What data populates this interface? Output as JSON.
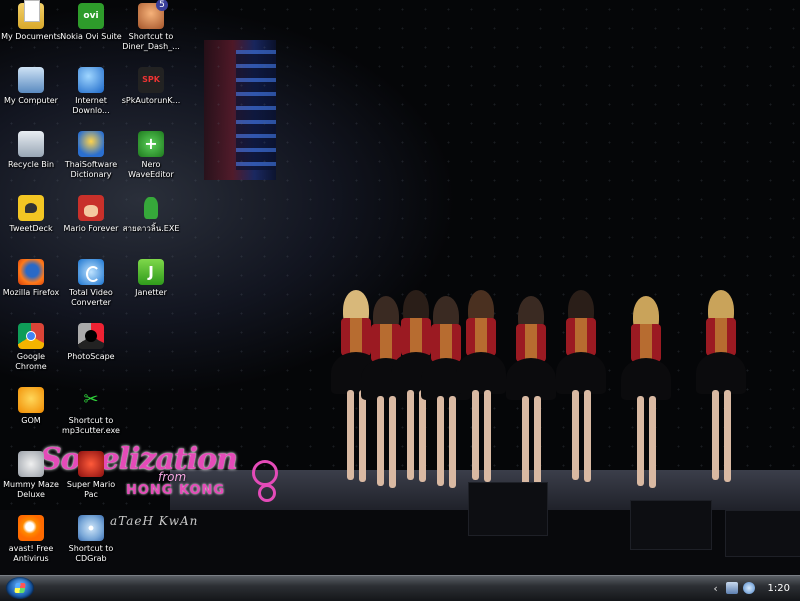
{
  "desktop": {
    "icons": [
      {
        "label": "My Documents",
        "icon": "documents-folder-icon"
      },
      {
        "label": "Nokia Ovi Suite",
        "icon": "ovi-icon",
        "glyph": "ovi"
      },
      {
        "label": "Shortcut to Diner_Dash_...",
        "icon": "diner-dash-icon"
      },
      {
        "label": "My Computer",
        "icon": "computer-icon"
      },
      {
        "label": "Internet Downlo...",
        "icon": "internet-download-icon"
      },
      {
        "label": "sPkAutorunK...",
        "icon": "spk-icon",
        "glyph": "SPK"
      },
      {
        "label": "Recycle Bin",
        "icon": "recycle-bin-icon"
      },
      {
        "label": "ThaiSoftware Dictionary",
        "icon": "dictionary-globe-icon"
      },
      {
        "label": "Nero WaveEditor",
        "icon": "nero-icon"
      },
      {
        "label": "TweetDeck",
        "icon": "tweetdeck-bird-icon"
      },
      {
        "label": "Mario Forever",
        "icon": "mario-icon"
      },
      {
        "label": "สายดาวลิ้น.EXE",
        "icon": "green-figure-exe-icon"
      },
      {
        "label": "Mozilla Firefox",
        "icon": "firefox-icon"
      },
      {
        "label": "Total Video Converter",
        "icon": "video-converter-icon"
      },
      {
        "label": "Janetter",
        "icon": "janetter-icon"
      },
      {
        "label": "Google Chrome",
        "icon": "chrome-icon"
      },
      {
        "label": "PhotoScape",
        "icon": "photoscape-icon"
      },
      {
        "label": "GOM",
        "icon": "gom-player-icon"
      },
      {
        "label": "Shortcut to mp3cutter.exe",
        "icon": "scissors-icon"
      },
      {
        "label": "Mummy Maze Deluxe",
        "icon": "mummy-icon"
      },
      {
        "label": "Super Mario Pac",
        "icon": "super-mario-icon"
      },
      {
        "label": "avast! Free Antivirus",
        "icon": "avast-icon"
      },
      {
        "label": "Shortcut to CDGrab",
        "icon": "cd-icon"
      }
    ]
  },
  "wallpaper": {
    "watermark_main": "Sonelization",
    "watermark_from": "from",
    "watermark_place": "HONG KONG",
    "watermark_signature": "aTaeH KwAn"
  },
  "taskbar": {
    "start_icon": "windows-logo-icon",
    "tray_chevron": "‹",
    "clock": "1:20"
  },
  "colors": {
    "watermark_pink": "#e44bb8",
    "taskbar_dark": "#141619",
    "skirt_black": "#0b0b0d",
    "costume_red": "#9b1a22"
  }
}
